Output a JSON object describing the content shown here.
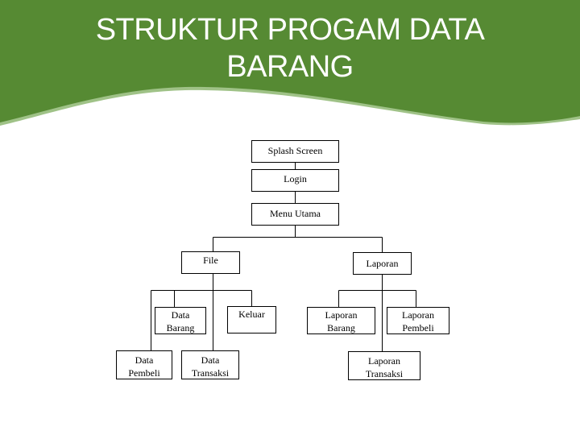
{
  "title": {
    "line1": "STRUKTUR PROGAM DATA",
    "line2": "BARANG"
  },
  "colors": {
    "banner": "#568a33",
    "banner_edge": "#9fc287",
    "line": "#000000"
  },
  "nodes": {
    "splash": {
      "lines": [
        "Splash Screen"
      ]
    },
    "login": {
      "lines": [
        "Login"
      ]
    },
    "menu": {
      "lines": [
        "Menu Utama"
      ]
    },
    "file": {
      "lines": [
        "File"
      ]
    },
    "laporan": {
      "lines": [
        "Laporan"
      ]
    },
    "data_barang": {
      "lines": [
        "Data",
        "Barang"
      ]
    },
    "keluar": {
      "lines": [
        "Keluar"
      ]
    },
    "data_pembeli": {
      "lines": [
        "Data",
        "Pembeli"
      ]
    },
    "data_transaksi": {
      "lines": [
        "Data",
        "Transaksi"
      ]
    },
    "laporan_barang": {
      "lines": [
        "Laporan",
        "Barang"
      ]
    },
    "laporan_pembeli": {
      "lines": [
        "Laporan",
        "Pembeli"
      ]
    },
    "laporan_transaksi": {
      "lines": [
        "Laporan",
        "Transaksi"
      ]
    }
  }
}
